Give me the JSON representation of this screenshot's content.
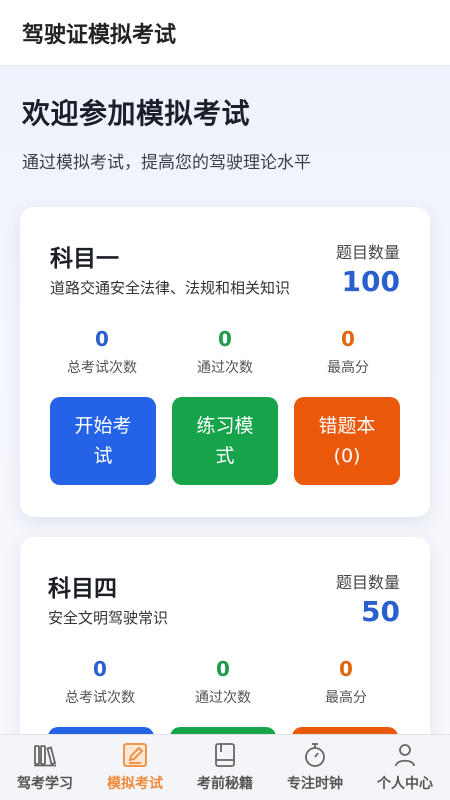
{
  "header": {
    "title": "驾驶证模拟考试"
  },
  "hero": {
    "title": "欢迎参加模拟考试",
    "subtitle": "通过模拟考试，提高您的驾驶理论水平"
  },
  "subjects": [
    {
      "name": "科目一",
      "description": "道路交通安全法律、法规和相关知识",
      "count_label": "题目数量",
      "count_value": "100",
      "stats": [
        {
          "value": "0",
          "label": "总考试次数"
        },
        {
          "value": "0",
          "label": "通过次数"
        },
        {
          "value": "0",
          "label": "最高分"
        }
      ],
      "buttons": {
        "start": "开始考试",
        "practice": "练习模式",
        "wrong_book": "错题本",
        "wrong_count": "(0)"
      }
    },
    {
      "name": "科目四",
      "description": "安全文明驾驶常识",
      "count_label": "题目数量",
      "count_value": "50",
      "stats": [
        {
          "value": "0",
          "label": "总考试次数"
        },
        {
          "value": "0",
          "label": "通过次数"
        },
        {
          "value": "0",
          "label": "最高分"
        }
      ]
    }
  ],
  "tabbar": {
    "items": [
      {
        "label": "驾考学习",
        "icon": "books-icon"
      },
      {
        "label": "模拟考试",
        "icon": "edit-icon",
        "active": true
      },
      {
        "label": "考前秘籍",
        "icon": "book-icon"
      },
      {
        "label": "专注时钟",
        "icon": "timer-icon"
      },
      {
        "label": "个人中心",
        "icon": "user-icon"
      }
    ]
  },
  "colors": {
    "primary": "#2563e6",
    "success": "#16a34a",
    "warning": "#ea580c",
    "active_tab": "#f08a3c"
  }
}
